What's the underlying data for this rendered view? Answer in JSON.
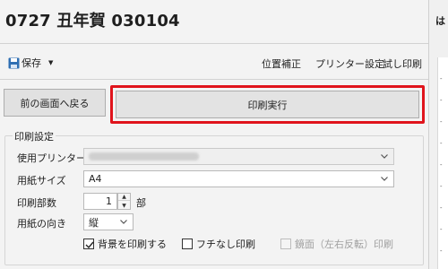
{
  "title": "0727 丑年賀 030104",
  "toolbar": {
    "save_label": "保存",
    "position_label": "位置補正",
    "printer_settings_label": "プリンター設定",
    "test_print_label": "試し印刷"
  },
  "buttons": {
    "back_label": "前の画面へ戻る",
    "execute_label": "印刷実行"
  },
  "print_settings": {
    "group_title": "印刷設定",
    "printer_label": "使用プリンター",
    "paper_size_label": "用紙サイズ",
    "paper_size_value": "A4",
    "copies_label": "印刷部数",
    "copies_value": "1",
    "copies_unit": "部",
    "orientation_label": "用紙の向き",
    "orientation_value": "縦",
    "print_background_label": "背景を印刷する",
    "print_background_checked": true,
    "borderless_label": "フチなし印刷",
    "borderless_checked": false,
    "mirror_label": "鏡面（左右反転）印刷",
    "mirror_checked": false,
    "mirror_enabled": false
  },
  "right_panel": {
    "title": "は"
  },
  "colors": {
    "highlight_border": "#e0141c",
    "save_icon": "#2f6fb3"
  },
  "icons": {
    "save": "floppy-disk-icon",
    "dropdown": "chevron-down-icon"
  }
}
